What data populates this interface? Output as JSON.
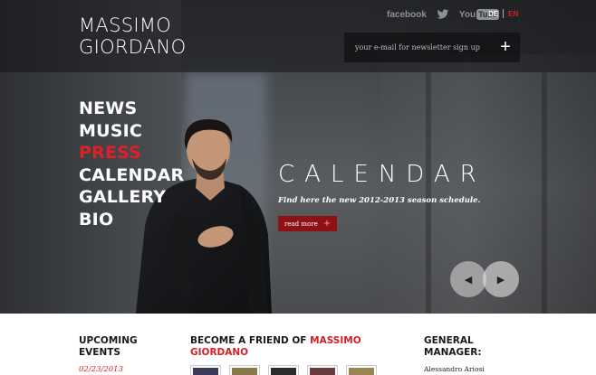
{
  "site": {
    "logo_line1": "MASSIMO",
    "logo_line2": "GIORDANO"
  },
  "social": {
    "facebook": "facebook",
    "twitter_icon": "twitter-bird-icon",
    "youtube_you": "You",
    "youtube_tube": "Tube"
  },
  "languages": {
    "de": "DE",
    "en": "EN",
    "active": "EN"
  },
  "newsletter": {
    "placeholder": "your e-mail for newsletter sign up",
    "value": "",
    "submit_icon": "plus-icon"
  },
  "nav": {
    "items": [
      {
        "label": "NEWS",
        "active": false
      },
      {
        "label": "MUSIC",
        "active": false
      },
      {
        "label": "PRESS",
        "active": true
      },
      {
        "label": "CALENDAR",
        "active": false
      },
      {
        "label": "GALLERY",
        "active": false
      },
      {
        "label": "BIO",
        "active": false
      }
    ]
  },
  "feature": {
    "title": "CALENDAR",
    "subtitle": "Find here the new 2012-2013 season schedule.",
    "read_more": "read more",
    "read_more_icon": "plus-icon"
  },
  "slider": {
    "prev_icon": "chevron-left-icon",
    "next_icon": "chevron-right-icon"
  },
  "upcoming": {
    "heading_line1": "UPCOMING",
    "heading_line2": "EVENTS",
    "date": "02/23/2013"
  },
  "friend": {
    "heading_prefix": "BECOME A FRIEND OF ",
    "heading_name1": "MASSIMO",
    "heading_name2": "GIORDANO"
  },
  "manager": {
    "heading_line1": "GENERAL",
    "heading_line2": "MANAGER:",
    "name": "Alessandro Ariosi"
  },
  "colors": {
    "accent_red": "#d61f26",
    "button_red": "#8e1116"
  }
}
